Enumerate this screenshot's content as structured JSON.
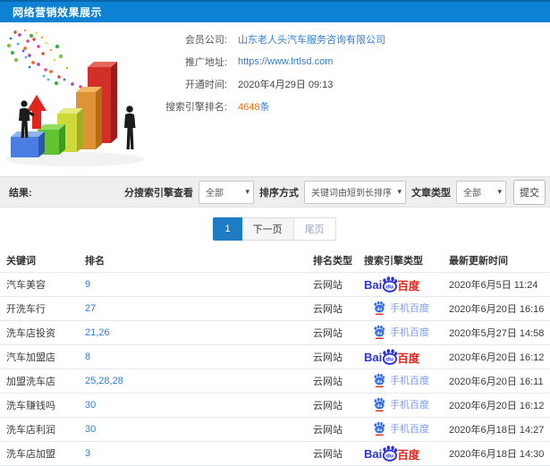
{
  "titlebar": {
    "title": "网络营销效果展示"
  },
  "info": {
    "fields": [
      {
        "label": "会员公司:",
        "value": "山东老人头汽车服务咨询有限公司",
        "type": "link"
      },
      {
        "label": "推广地址:",
        "value": "https://www.lrtlsd.com",
        "type": "link"
      },
      {
        "label": "开通时间:",
        "value": "2020年4月29日 09:13",
        "type": "text"
      },
      {
        "label": "搜索引擎排名:",
        "value": "4648",
        "suffix": "条",
        "type": "count"
      }
    ]
  },
  "filters": {
    "result_label": "结果:",
    "engine_label": "分搜索引擎查看",
    "engine_value": "全部",
    "sort_label": "排序方式",
    "sort_value": "关键词由短到长排序",
    "type_label": "文章类型",
    "type_value": "全部",
    "submit_label": "提交"
  },
  "pagination": {
    "current": "1",
    "next": "下一页",
    "last": "尾页"
  },
  "table": {
    "headers": [
      "关键词",
      "排名",
      "排名类型",
      "搜索引擎类型",
      "最新更新时间"
    ],
    "engine_labels": {
      "bai": "Bai",
      "du": "du",
      "cn": "百度",
      "mobile": "手机百度"
    },
    "rows": [
      {
        "keyword": "汽车美容",
        "rank": "9",
        "rank_type": "云网站",
        "engine": "baidu",
        "time": "2020年6月5日 11:24"
      },
      {
        "keyword": "开洗车行",
        "rank": "27",
        "rank_type": "云网站",
        "engine": "mobile-baidu",
        "time": "2020年6月20日 16:16"
      },
      {
        "keyword": "洗车店投资",
        "rank": "21,26",
        "rank_type": "云网站",
        "engine": "mobile-baidu",
        "time": "2020年5月27日 14:58"
      },
      {
        "keyword": "汽车加盟店",
        "rank": "8",
        "rank_type": "云网站",
        "engine": "baidu",
        "time": "2020年6月20日 16:12"
      },
      {
        "keyword": "加盟洗车店",
        "rank": "25,28,28",
        "rank_type": "云网站",
        "engine": "mobile-baidu",
        "time": "2020年6月20日 16:11"
      },
      {
        "keyword": "洗车赚钱吗",
        "rank": "30",
        "rank_type": "云网站",
        "engine": "mobile-baidu",
        "time": "2020年6月20日 16:12"
      },
      {
        "keyword": "洗车店利润",
        "rank": "30",
        "rank_type": "云网站",
        "engine": "mobile-baidu",
        "time": "2020年6月18日 14:27"
      },
      {
        "keyword": "洗车店加盟",
        "rank": "3",
        "rank_type": "云网站",
        "engine": "baidu",
        "time": "2020年6月18日 14:30"
      }
    ]
  }
}
